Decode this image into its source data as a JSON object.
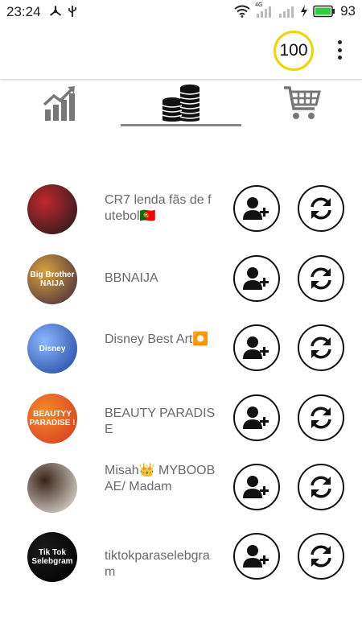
{
  "status_bar": {
    "time": "23:24",
    "battery_percent": "93",
    "network_label": "4G",
    "icons": [
      "network-share-icon",
      "usb-icon",
      "wifi-icon",
      "signal-icon",
      "charging-icon",
      "battery-icon"
    ]
  },
  "app_bar": {
    "coins": "100",
    "badge_color": "#f0d400"
  },
  "tabs": [
    {
      "name": "stats",
      "icon": "chart-growth-icon",
      "selected": false
    },
    {
      "name": "coins",
      "icon": "coins-stack-icon",
      "selected": true
    },
    {
      "name": "shop",
      "icon": "shopping-cart-icon",
      "selected": false
    }
  ],
  "accounts": [
    {
      "name": "CR7 lenda fãs de futebol🇵🇹",
      "avatar_colors": [
        "#1a1a1a",
        "#c0282d"
      ],
      "avatar_text": ""
    },
    {
      "name": "BBNAIJA",
      "avatar_colors": [
        "#3a2340",
        "#d9a23b"
      ],
      "avatar_text": "Big Brother NAIJA"
    },
    {
      "name": "Disney Best Art⏺️",
      "avatar_colors": [
        "#1d3f9a",
        "#8ab8ff"
      ],
      "avatar_text": "Disney"
    },
    {
      "name": "BEAUTY PARADISE",
      "avatar_colors": [
        "#d8361f",
        "#f28a2b"
      ],
      "avatar_text": "BEAUTYY PARADISE !"
    },
    {
      "name": "Misah👑 MYBOOBAE/ Madam",
      "avatar_colors": [
        "#f2efe9",
        "#3b2418"
      ],
      "avatar_text": ""
    },
    {
      "name": "tiktokparaselebgram",
      "avatar_colors": [
        "#000000",
        "#1a1a1a"
      ],
      "avatar_text": "Tik Tok Selebgram"
    }
  ],
  "actions": {
    "follow_icon": "add-user-icon",
    "refresh_icon": "refresh-icon"
  }
}
